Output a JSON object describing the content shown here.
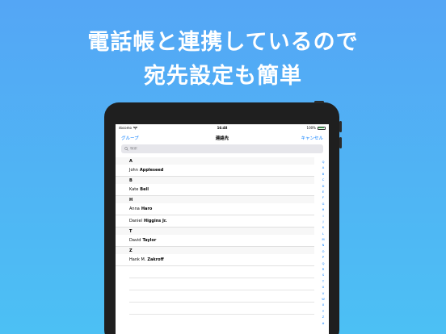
{
  "promo": {
    "line1": "電話帳と連携しているので",
    "line2": "宛先設定も簡単"
  },
  "status_bar": {
    "carrier": "docomo",
    "time": "16:48",
    "battery": "100%"
  },
  "nav": {
    "left": "グループ",
    "title": "連絡先",
    "right": "キャンセル"
  },
  "search": {
    "placeholder": "検索"
  },
  "sections": [
    {
      "letter": "A",
      "contacts": [
        {
          "first": "John",
          "last": "Appleseed"
        }
      ]
    },
    {
      "letter": "B",
      "contacts": [
        {
          "first": "Kate",
          "last": "Bell"
        }
      ]
    },
    {
      "letter": "H",
      "contacts": [
        {
          "first": "Anna",
          "last": "Haro"
        },
        {
          "first": "Daniel",
          "last": "Higgins Jr."
        }
      ]
    },
    {
      "letter": "T",
      "contacts": [
        {
          "first": "David",
          "last": "Taylor"
        }
      ]
    },
    {
      "letter": "Z",
      "contacts": [
        {
          "first": "Hank M.",
          "last": "Zakroff"
        }
      ]
    }
  ],
  "index_letters": [
    "Q",
    "A",
    "B",
    "C",
    "D",
    "E",
    "F",
    "G",
    "H",
    "I",
    "J",
    "K",
    "L",
    "M",
    "N",
    "O",
    "P",
    "Q",
    "R",
    "S",
    "T",
    "U",
    "V",
    "W",
    "X",
    "Y",
    "Z",
    "#"
  ],
  "colors": {
    "accent": "#007aff",
    "background_top": "#54a6f5",
    "background_bottom": "#4cc0f4"
  }
}
